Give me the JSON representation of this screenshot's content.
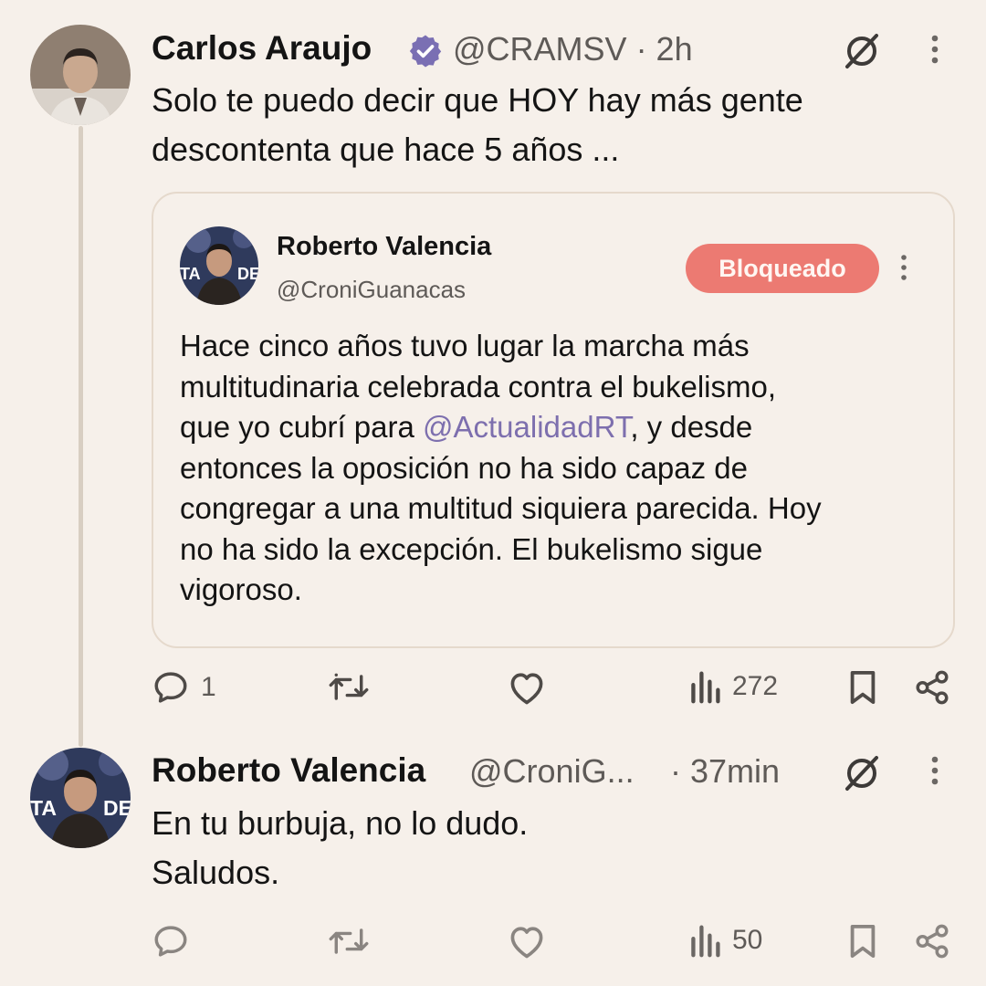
{
  "tweet1": {
    "author_name": "Carlos Araujo",
    "verified": true,
    "handle_time": "@CRAMSV · 2h",
    "text_lines": [
      "Solo te puedo decir que HOY hay más gente",
      "descontenta que hace 5 años ..."
    ],
    "quote": {
      "author_name": "Roberto Valencia",
      "handle": "@CroniGuanacas",
      "badge": "Bloqueado",
      "lines": [
        "Hace cinco años tuvo lugar la marcha más",
        "multitudinaria celebrada contra el bukelismo,",
        "que yo cubrí para ",
        "@ActualidadRT",
        ", y desde",
        "entonces la oposición no ha sido capaz de",
        "congregar a una multitud siquiera parecida. Hoy",
        "no ha sido la excepción. El bukelismo sigue",
        "vigoroso."
      ]
    },
    "actions": {
      "replies": "1",
      "views": "272"
    }
  },
  "tweet2": {
    "author_name": "Roberto Valencia",
    "handle": "@CroniG...",
    "time": "· 37min",
    "text_lines": [
      "En tu burbuja, no lo dudo.",
      "Saludos."
    ],
    "actions": {
      "views": "50"
    }
  },
  "colors": {
    "background": "#f6f0ea",
    "badge": "#ec7a72",
    "mention": "#7d6fae",
    "verified": "#7a6fb3"
  },
  "icons": [
    "grok-icon",
    "more-icon",
    "reply-icon",
    "retweet-icon",
    "like-icon",
    "views-icon",
    "bookmark-icon",
    "share-icon",
    "verified-badge-icon"
  ]
}
